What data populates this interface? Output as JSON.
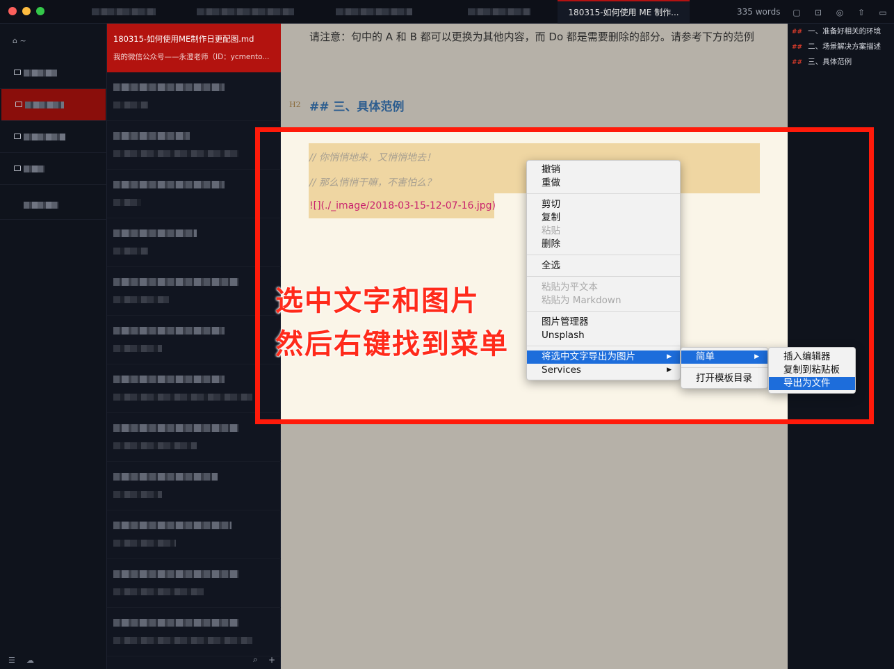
{
  "titlebar": {
    "active_tab": "180315-如何使用 ME 制作...",
    "word_count": "335 words"
  },
  "sidebar": {
    "home_label": "⌂ ~"
  },
  "filelist": {
    "active_file": {
      "title": "180315-如何使用ME制作日更配图.md",
      "subtitle": "我的微信公众号——永澄老师（ID：ycmento..."
    }
  },
  "editor": {
    "paragraph": "请注意：句中的 A 和 B 都可以更换为其他内容，而 Do 都是需要删除的部分。请参考下方的范例",
    "heading_marker": "H2",
    "heading": "## 三、具体范例",
    "code_line_1": "// 你悄悄地来，又悄悄地去！",
    "code_line_2": "// 那么悄悄干嘛，不害怕么？",
    "image_line": "![](./_image/2018-03-15-12-07-16.jpg)"
  },
  "outline": {
    "items": [
      "一、准备好相关的环境",
      "二、场景解决方案描述",
      "三、具体范例"
    ]
  },
  "annotation": {
    "line1": "选中文字和图片",
    "line2": "然后右键找到菜单"
  },
  "context_menu": {
    "undo": "撤销",
    "redo": "重做",
    "cut": "剪切",
    "copy": "复制",
    "paste": "粘贴",
    "delete": "删除",
    "select_all": "全选",
    "paste_plain": "粘贴为平文本",
    "paste_markdown": "粘贴为 Markdown",
    "image_manager": "图片管理器",
    "unsplash": "Unsplash",
    "export_selection": "将选中文字导出为图片",
    "services": "Services"
  },
  "submenu_1": {
    "simple": "简单",
    "open_templates": "打开模板目录"
  },
  "submenu_2": {
    "insert_editor": "插入编辑器",
    "copy_clipboard": "复制到粘贴板",
    "export_file": "导出为文件"
  },
  "colors": {
    "accent_red": "#b3130f",
    "highlight_box": "#ff1a0a",
    "menu_highlight": "#1d6ddb",
    "heading_blue": "#2c5d8f",
    "link_magenta": "#c8216d"
  }
}
